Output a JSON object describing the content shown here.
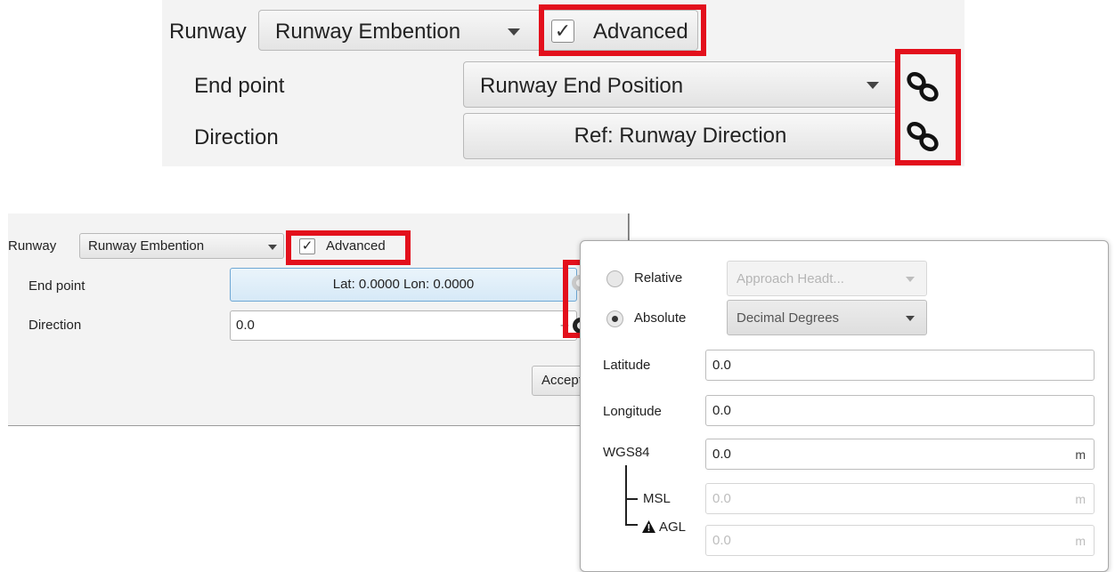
{
  "top_panel": {
    "runway_label": "Runway",
    "runway_combo_value": "Runway Embention",
    "advanced_checked": "✓",
    "advanced_label": "Advanced",
    "end_point_label": "End point",
    "end_point_value": "Runway End Position",
    "direction_label": "Direction",
    "direction_value": "Ref: Runway Direction"
  },
  "dialog": {
    "runway_label": "Runway",
    "runway_combo_value": "Runway Embention",
    "advanced_checked": "✓",
    "advanced_label": "Advanced",
    "end_point_label": "End point",
    "end_point_value": "Lat: 0.0000  Lon: 0.0000",
    "direction_label": "Direction",
    "direction_value": "0.0",
    "direction_suffix": "--",
    "accept_label": "Accept"
  },
  "popup": {
    "relative_label": "Relative",
    "relative_combo_value": "Approach Headt...",
    "absolute_label": "Absolute",
    "absolute_combo_value": "Decimal Degrees",
    "latitude_label": "Latitude",
    "latitude_value": "0.0",
    "longitude_label": "Longitude",
    "longitude_value": "0.0",
    "wgs84_label": "WGS84",
    "wgs84_value": "0.0",
    "wgs84_unit": "m",
    "msl_label": "MSL",
    "msl_value": "0.0",
    "msl_unit": "m",
    "agl_label": "AGL",
    "agl_value": "0.0",
    "agl_unit": "m",
    "warning_icon": "warning-icon"
  },
  "colors": {
    "highlight": "#e3101c",
    "selected_button": "#d6e9f7"
  },
  "icons": [
    "link-icon",
    "gear-icon",
    "checkbox-checked-icon",
    "chevron-down-icon",
    "warning-icon"
  ]
}
